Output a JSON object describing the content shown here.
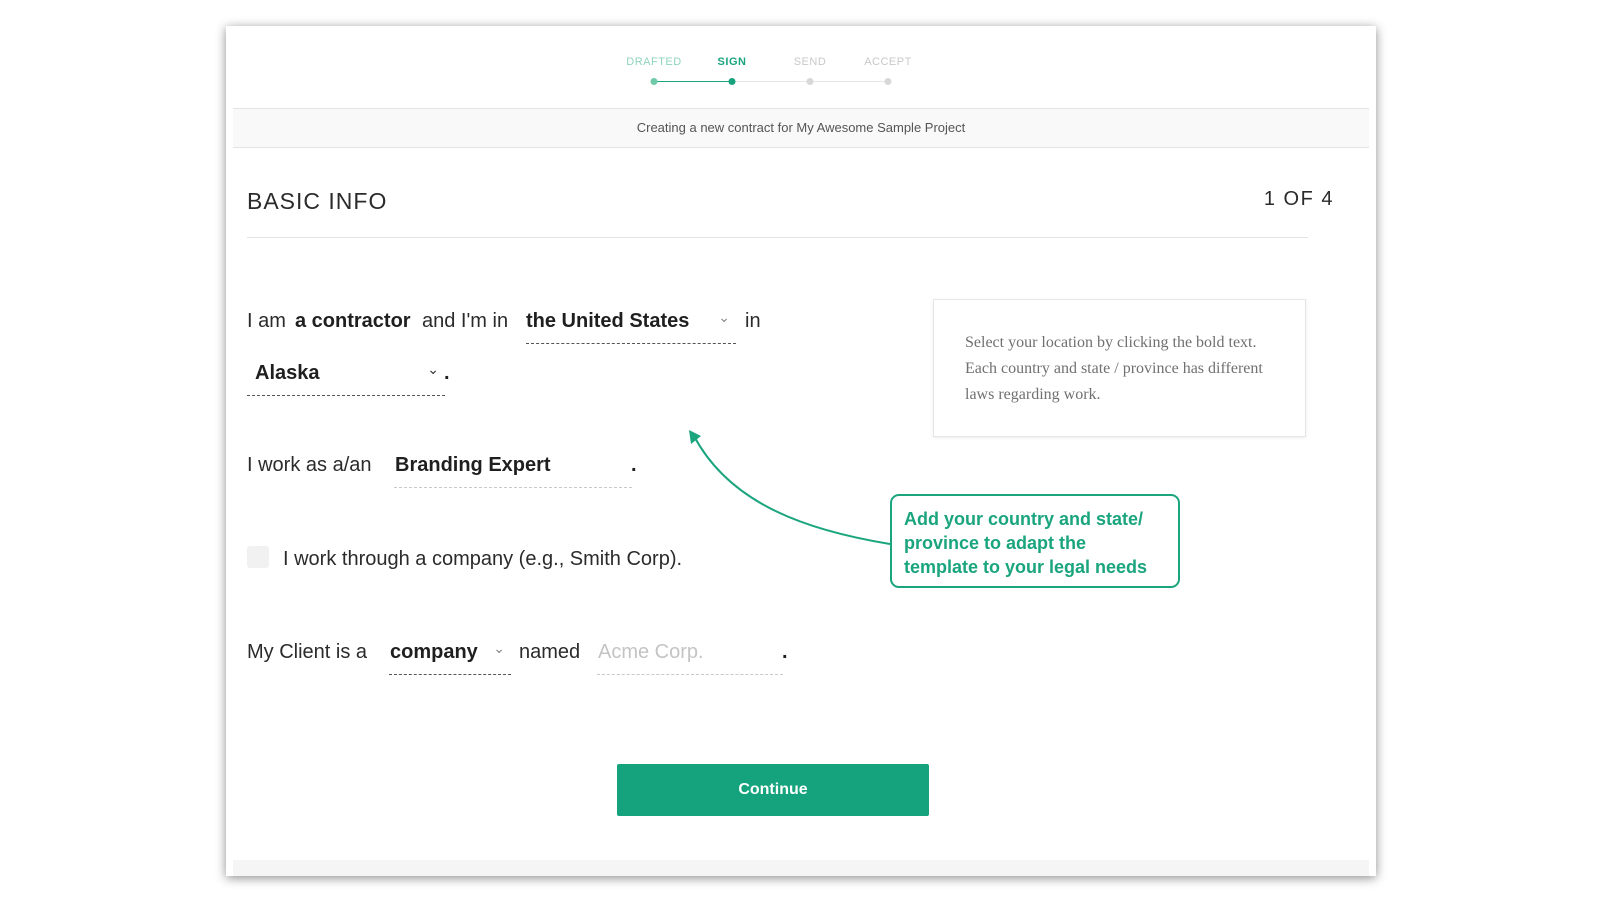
{
  "stepper": {
    "steps": [
      {
        "label": "DRAFTED",
        "state": "done"
      },
      {
        "label": "SIGN",
        "state": "active"
      },
      {
        "label": "SEND",
        "state": "pending"
      },
      {
        "label": "ACCEPT",
        "state": "pending"
      }
    ]
  },
  "subheader": {
    "text": "Creating a new contract for My Awesome Sample Project"
  },
  "section": {
    "title": "BASIC INFO",
    "progress": "1 OF 4"
  },
  "form": {
    "line1": {
      "prefix": "I am",
      "role": "a contractor",
      "middle": "and I'm in",
      "country": "the United States",
      "suffix": "in",
      "state": "Alaska",
      "end": "."
    },
    "line2": {
      "prefix": "I work as a/an",
      "profession": "Branding Expert",
      "end": "."
    },
    "line3": {
      "checkbox_label": "I work through a company (e.g., Smith Corp).",
      "checked": false
    },
    "line4": {
      "prefix": "My Client is a",
      "client_type": "company",
      "middle": "named",
      "client_name_placeholder": "Acme Corp.",
      "end": "."
    }
  },
  "hint": {
    "text": "Select your location by clicking the bold text. Each country and state / province has different laws regarding work."
  },
  "callout": {
    "text": "Add your country and state/ province to adapt the template to your legal needs"
  },
  "continue_button": {
    "label": "Continue"
  },
  "colors": {
    "accent": "#1aa57e",
    "button": "#14a37c"
  },
  "icons": {
    "dropdown": "chevron-down-icon",
    "arrow": "curved-arrow-icon"
  }
}
